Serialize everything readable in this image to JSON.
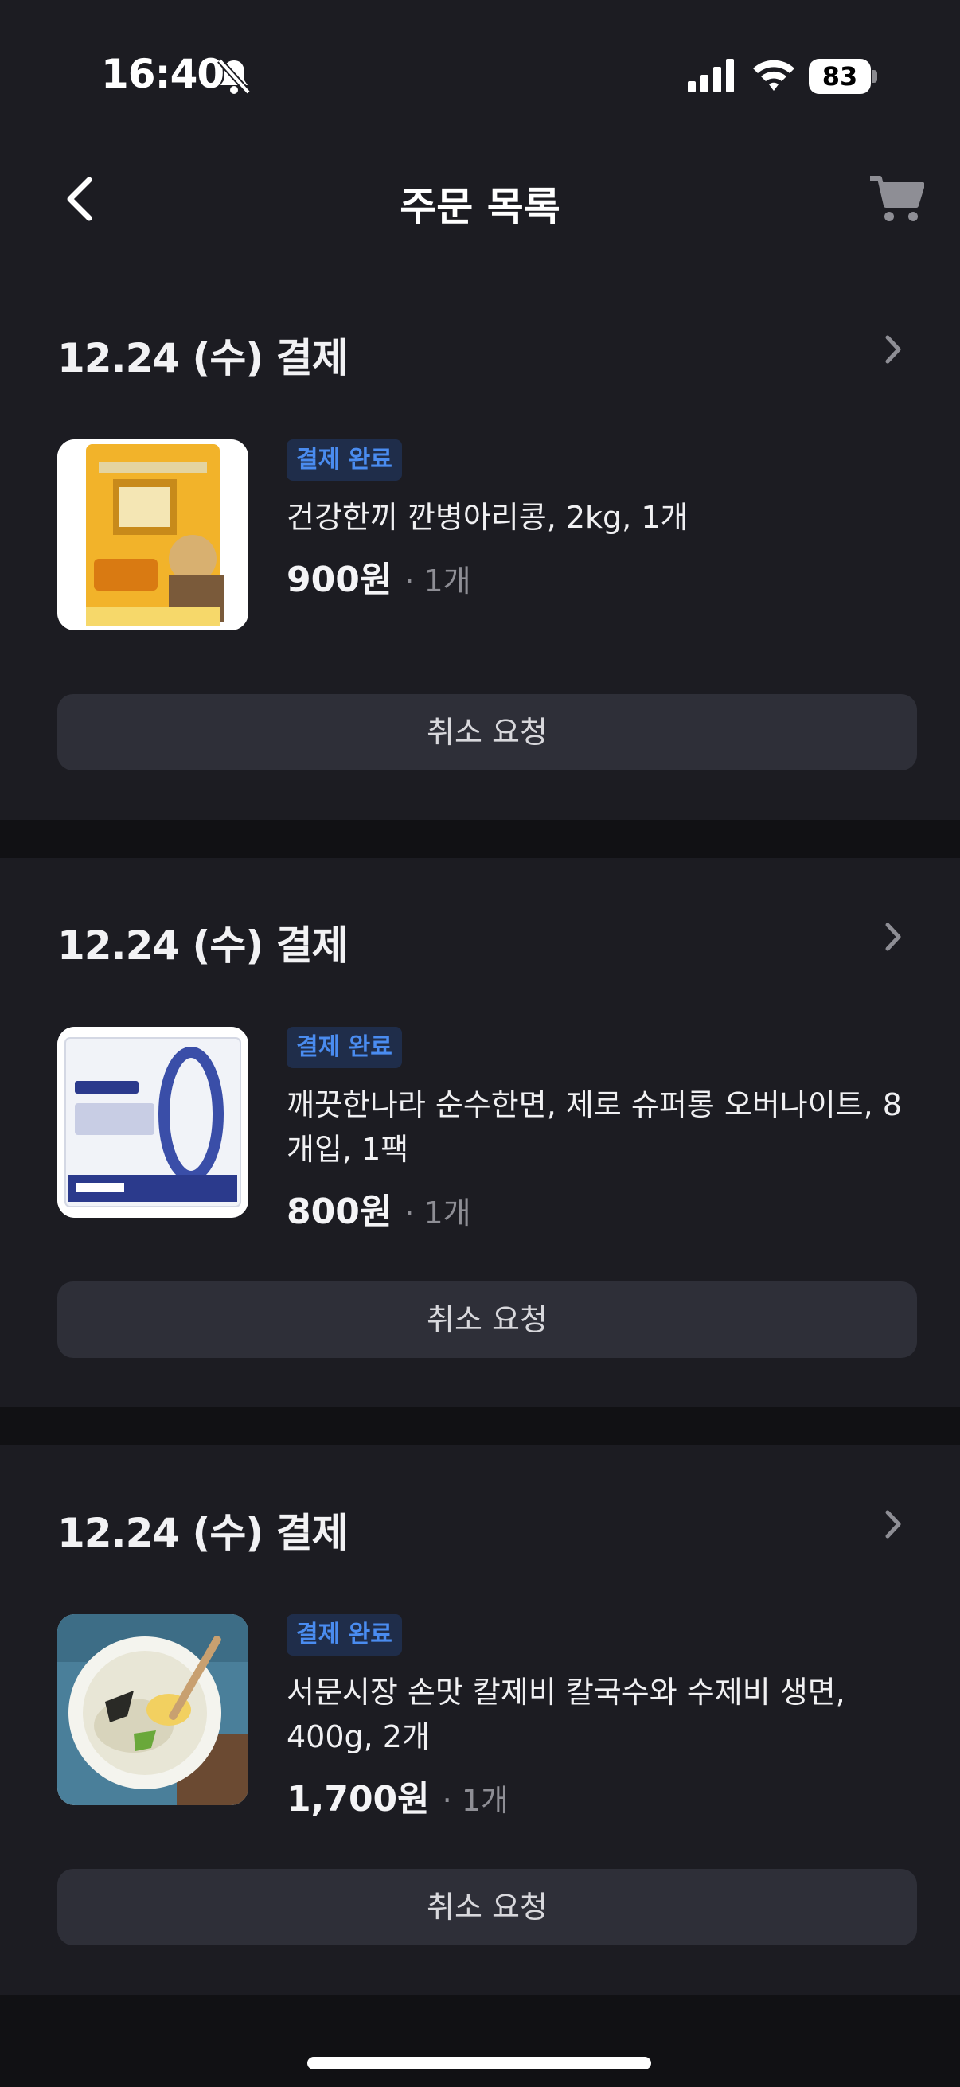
{
  "status_bar": {
    "time": "16:40",
    "battery": "83"
  },
  "nav": {
    "title": "주문 목록"
  },
  "colors": {
    "background": "#1c1c22",
    "badge_text": "#4a8cf0",
    "badge_bg": "#1f2d4a",
    "button_bg": "#2e2f38"
  },
  "icons": {
    "back": "chevron-left-icon",
    "cart": "cart-icon",
    "silent": "bell-slash-icon",
    "signal": "signal-icon",
    "wifi": "wifi-icon",
    "order_detail": "chevron-right-icon"
  },
  "orders": [
    {
      "date": "12.24 (수) 결제",
      "status": "결제 완료",
      "product_name": "건강한끼 깐병아리콩, 2kg, 1개",
      "price": "900원",
      "quantity": "· 1개",
      "cancel_label": "취소 요청"
    },
    {
      "date": "12.24 (수) 결제",
      "status": "결제 완료",
      "product_name": "깨끗한나라 순수한면, 제로 슈퍼롱 오버나이트, 8개입, 1팩",
      "price": "800원",
      "quantity": "· 1개",
      "cancel_label": "취소 요청"
    },
    {
      "date": "12.24 (수) 결제",
      "status": "결제 완료",
      "product_name": "서문시장 손맛 칼제비 칼국수와 수제비 생면, 400g, 2개",
      "price": "1,700원",
      "quantity": "· 1개",
      "cancel_label": "취소 요청"
    }
  ]
}
